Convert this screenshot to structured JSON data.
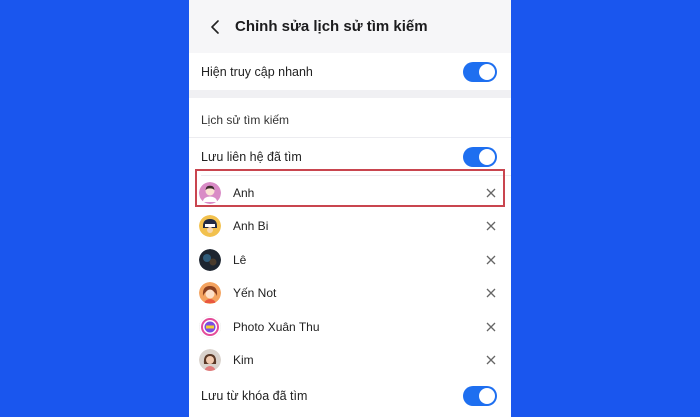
{
  "header": {
    "title": "Chỉnh sửa lịch sử tìm kiếm",
    "back_icon": "chevron-left-icon"
  },
  "quick_access": {
    "label": "Hiện truy cập nhanh",
    "enabled": true
  },
  "history_section": {
    "title": "Lịch sử tìm kiếm"
  },
  "save_contacts": {
    "label": "Lưu liên hệ đã tìm",
    "enabled": true
  },
  "contacts": [
    {
      "name": "Anh",
      "avatar": "pink-person-avatar",
      "highlighted": true
    },
    {
      "name": "Anh Bi",
      "avatar": "masked-hero-avatar",
      "highlighted": false
    },
    {
      "name": "Lê",
      "avatar": "dark-photo-avatar",
      "highlighted": false
    },
    {
      "name": "Yến Not",
      "avatar": "girl-avatar",
      "highlighted": false
    },
    {
      "name": "Photo Xuân Thu",
      "avatar": "colorful-logo-avatar",
      "highlighted": false
    },
    {
      "name": "Kim",
      "avatar": "woman-photo-avatar",
      "highlighted": false
    }
  ],
  "save_keywords": {
    "label": "Lưu từ khóa đã tìm",
    "enabled": true
  },
  "colors": {
    "background": "#1a56ee",
    "toggle_on": "#1e6ff0",
    "highlight_border": "#c9454f"
  }
}
